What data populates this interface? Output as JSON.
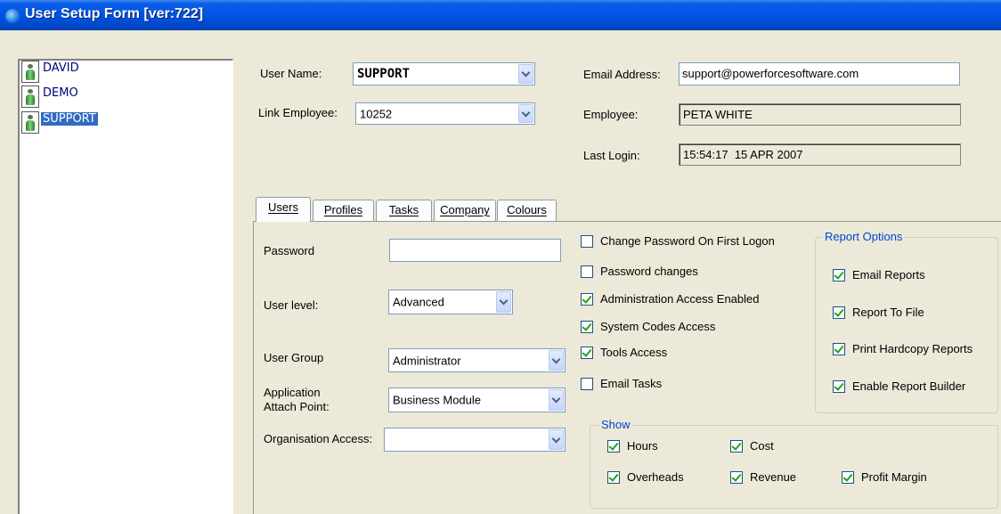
{
  "window": {
    "title": "User Setup Form [ver:722]"
  },
  "users": [
    {
      "name": "DAVID",
      "selected": false
    },
    {
      "name": "DEMO",
      "selected": false
    },
    {
      "name": "SUPPORT",
      "selected": true
    }
  ],
  "header": {
    "user_name_label": "User Name:",
    "user_name_value": "SUPPORT",
    "link_employee_label": "Link Employee:",
    "link_employee_value": "10252",
    "email_label": "Email Address:",
    "email_value": "support@powerforcesoftware.com",
    "employee_label": "Employee:",
    "employee_value": "PETA WHITE",
    "last_login_label": "Last Login:",
    "last_login_value": "15:54:17  15 APR 2007"
  },
  "tabs": [
    {
      "label": "Users",
      "active": true
    },
    {
      "label": "Profiles",
      "active": false
    },
    {
      "label": "Tasks",
      "active": false
    },
    {
      "label": "Company",
      "active": false
    },
    {
      "label": "Colours",
      "active": false
    }
  ],
  "users_tab": {
    "password_label": "Password",
    "password_value": "",
    "user_level_label": "User level:",
    "user_level_value": "Advanced",
    "user_group_label": "User Group",
    "user_group_value": "Administrator",
    "attach_point_label_1": "Application",
    "attach_point_label_2": "Attach Point:",
    "attach_point_value": "Business Module",
    "org_access_label": "Organisation Access:",
    "org_access_value": "",
    "checks": [
      {
        "label": "Change Password On First Logon",
        "checked": false
      },
      {
        "label": "Password changes",
        "checked": false
      },
      {
        "label": "Administration Access Enabled",
        "checked": true
      },
      {
        "label": "System Codes Access",
        "checked": true
      },
      {
        "label": "Tools Access",
        "checked": true
      },
      {
        "label": "Email Tasks",
        "checked": false
      }
    ],
    "report_options": {
      "title": "Report Options",
      "items": [
        {
          "label": "Email Reports",
          "checked": true
        },
        {
          "label": "Report To File",
          "checked": true
        },
        {
          "label": "Print Hardcopy Reports",
          "checked": true
        },
        {
          "label": "Enable Report Builder",
          "checked": true
        }
      ]
    },
    "show": {
      "title": "Show",
      "items": [
        {
          "label": "Hours",
          "checked": true
        },
        {
          "label": "Cost",
          "checked": true
        },
        {
          "label": "Overheads",
          "checked": true
        },
        {
          "label": "Revenue",
          "checked": true
        },
        {
          "label": "Profit Margin",
          "checked": true
        }
      ]
    }
  },
  "colors": {
    "title_bar": "#0054e3",
    "selection": "#316ac5",
    "group_title": "#0046d5",
    "check": "#21a121"
  }
}
